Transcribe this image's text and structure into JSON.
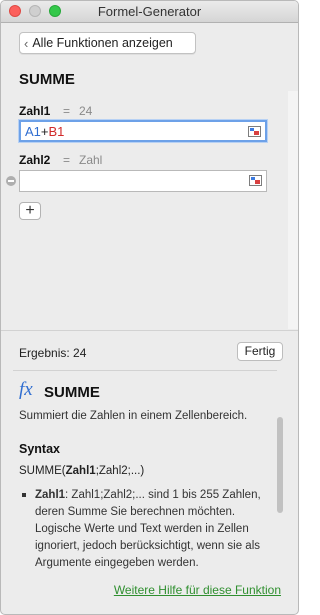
{
  "window": {
    "title": "Formel-Generator"
  },
  "back_button": {
    "label": "Alle Funktionen anzeigen"
  },
  "function_name": "SUMME",
  "arguments": [
    {
      "label": "Zahl1",
      "eq": "=",
      "value": "24",
      "input": {
        "ref_a": "A1",
        "op": "+",
        "ref_b": "B1"
      }
    },
    {
      "label": "Zahl2",
      "eq": "=",
      "value": "Zahl",
      "input": {
        "ref_a": "",
        "op": "",
        "ref_b": ""
      }
    }
  ],
  "add_button": {
    "label": "+"
  },
  "result": {
    "label": "Ergebnis: 24"
  },
  "done_button": {
    "label": "Fertig"
  },
  "help": {
    "fx": "fx",
    "title": "SUMME",
    "description": "Summiert die Zahlen in einem Zellenbereich.",
    "syntax_heading": "Syntax",
    "syntax_prefix": "SUMME(",
    "syntax_bold": "Zahl1",
    "syntax_suffix": ";Zahl2;...)",
    "bullet_bold": "Zahl1",
    "bullet_text": ": Zahl1;Zahl2;... sind 1 bis 255 Zahlen, deren Summe Sie berechnen möchten. Logische Werte und Text werden in Zellen ignoriert, jedoch berücksichtigt, wenn sie als Argumente eingegeben werden."
  },
  "more_help_link": "Weitere Hilfe für diese Funktion",
  "colors": {
    "ref_a": "#2f6dd0",
    "ref_b": "#d12a2a",
    "link": "#2f8f2f",
    "focus": "#6da1e8"
  }
}
